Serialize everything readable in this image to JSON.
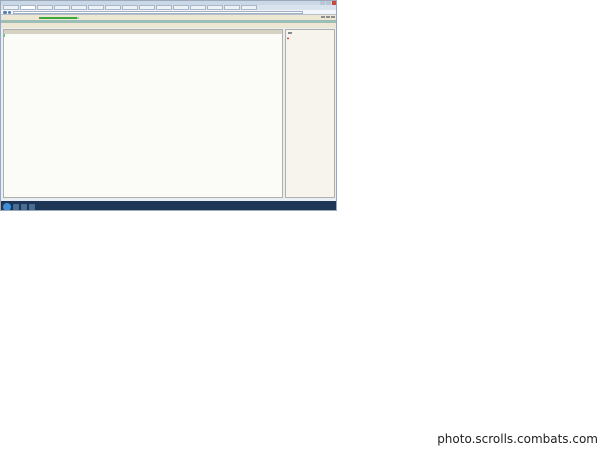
{
  "watermark": "photo.scrolls.combats.com",
  "browser": {
    "tabs": [
      "",
      "",
      "",
      "",
      "",
      "",
      "",
      "",
      "",
      "",
      "",
      "",
      "",
      "",
      ""
    ],
    "url": "",
    "zoom": ""
  },
  "game": {
    "hp_label": "",
    "hp_fill": 0.95,
    "menu": [
      "",
      "",
      "",
      "",
      "",
      ""
    ],
    "notice": ""
  },
  "chat": {
    "messages": [
      {
        "time": "",
        "nick": "",
        "text": "",
        "kind": "normal"
      }
    ]
  },
  "sidebar": {
    "rows": []
  },
  "taskbar": {
    "clock": ""
  }
}
